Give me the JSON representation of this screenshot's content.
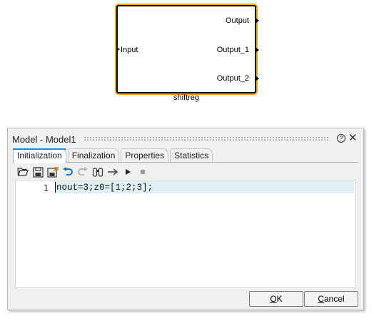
{
  "block": {
    "name": "shiftreg",
    "input_port": "Input",
    "output_ports": [
      "Output",
      "Output_1",
      "Output_2"
    ],
    "highlight_color": "#f0a329"
  },
  "dialog": {
    "title": "Model - Model1",
    "help_icon": "?",
    "close_icon": "✕",
    "tabs": [
      {
        "label": "Initialization",
        "active": true
      },
      {
        "label": "Finalization",
        "active": false
      },
      {
        "label": "Properties",
        "active": false
      },
      {
        "label": "Statistics",
        "active": false
      }
    ],
    "toolbar": [
      {
        "name": "open-folder-icon"
      },
      {
        "name": "save-icon"
      },
      {
        "name": "save-as-icon"
      },
      {
        "name": "undo-icon"
      },
      {
        "name": "redo-icon"
      },
      {
        "name": "find-icon"
      },
      {
        "name": "step-arrow-icon"
      },
      {
        "name": "run-icon"
      },
      {
        "name": "stop-icon"
      }
    ],
    "editor": {
      "lines": [
        {
          "number": "1",
          "code": "nout=3;z0=[1;2;3];"
        }
      ],
      "current_line_color": "#dff1f4"
    },
    "buttons": {
      "ok_mnemonic": "O",
      "ok_rest": "K",
      "cancel_mnemonic": "C",
      "cancel_rest": "ancel"
    }
  }
}
